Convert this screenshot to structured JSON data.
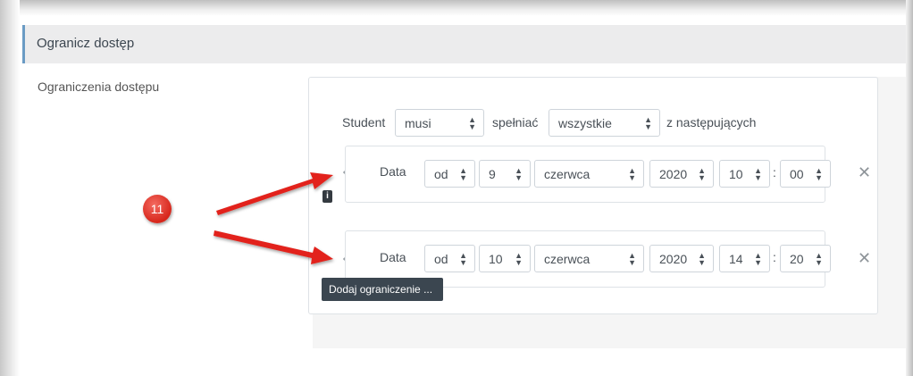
{
  "section": {
    "title": "Ogranicz dostęp",
    "field_label": "Ograniczenia dostępu"
  },
  "rule": {
    "prefix": "Student",
    "must": "musi",
    "meet": "spełniać",
    "all": "wszystkie",
    "suffix": "z następujących"
  },
  "conditions": [
    {
      "type": "Data",
      "direction": "od",
      "day": "9",
      "month": "czerwca",
      "year": "2020",
      "hour": "10",
      "minute": "00"
    },
    {
      "type": "Data",
      "direction": "od",
      "day": "10",
      "month": "czerwca",
      "year": "2020",
      "hour": "14",
      "minute": "20"
    }
  ],
  "time_separator": ":",
  "info_icon": "i",
  "add_button": "Dodaj ograniczenie ...",
  "annotation": {
    "number": "11",
    "color": "#e2231a"
  },
  "icons": {
    "eye": "eye-slash-icon",
    "close": "close-icon",
    "info": "info-icon"
  },
  "colors": {
    "header_bg": "#ececed",
    "header_accent": "#6a9bc4",
    "button_bg": "#3b4650"
  }
}
